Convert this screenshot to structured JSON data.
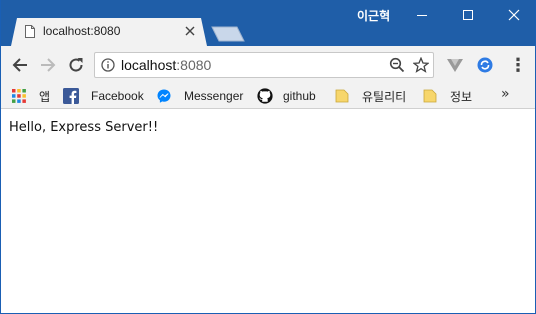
{
  "window": {
    "profile_name": "이근혁"
  },
  "tab": {
    "title": "localhost:8080",
    "close_glyph": "✕"
  },
  "toolbar": {
    "back_icon": "back-arrow-icon",
    "forward_icon": "forward-arrow-icon",
    "reload_icon": "reload-icon",
    "url_host": "localhost",
    "url_port": ":8080",
    "menu_glyph": "⋮"
  },
  "bookmarks": {
    "items": [
      {
        "label": "앱",
        "icon": "apps-grid-icon"
      },
      {
        "label": "Facebook",
        "icon": "facebook-icon"
      },
      {
        "label": "Messenger",
        "icon": "messenger-icon"
      },
      {
        "label": "github",
        "icon": "github-icon"
      },
      {
        "label": "유틸리티",
        "icon": "folder-icon"
      },
      {
        "label": "정보",
        "icon": "folder-icon"
      }
    ],
    "overflow_glyph": "»"
  },
  "page": {
    "text": "Hello, Express Server!!"
  },
  "colors": {
    "titlebar": "#1f5ea8",
    "chrome": "#f2f2f2",
    "facebook": "#3b5998",
    "messenger": "#0084ff",
    "folder": "#f7d66b"
  }
}
